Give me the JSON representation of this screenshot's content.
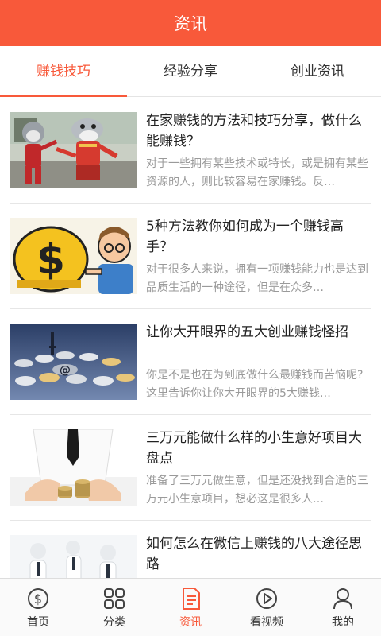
{
  "header": {
    "title": "资讯"
  },
  "tabs": [
    {
      "label": "赚钱技巧",
      "active": true
    },
    {
      "label": "经验分享",
      "active": false
    },
    {
      "label": "创业资讯",
      "active": false
    }
  ],
  "articles": [
    {
      "title": "在家赚钱的方法和技巧分享，做什么能赚钱？",
      "desc": "对于一些拥有某些技术或特长，或是拥有某些资源的人，则比较容易在家赚钱。反…"
    },
    {
      "title": "5种方法教你如何成为一个赚钱高手？",
      "desc": "对于很多人来说，拥有一项赚钱能力也是达到品质生活的一种途径，但是在众多…"
    },
    {
      "title": "让你大开眼界的五大创业赚钱怪招",
      "desc": "你是不是也在为到底做什么最赚钱而苦恼呢?这里告诉你让你大开眼界的5大赚钱…"
    },
    {
      "title": "三万元能做什么样的小生意好项目大盘点",
      "desc": "准备了三万元做生意，但是还没找到合适的三万元小生意项目，想必这是很多人…"
    },
    {
      "title": "如何怎么在微信上赚钱的八大途径思路",
      "desc": ""
    }
  ],
  "bottom_nav": [
    {
      "label": "首页",
      "icon": "dollar-coin-icon",
      "active": false
    },
    {
      "label": "分类",
      "icon": "grid-icon",
      "active": false
    },
    {
      "label": "资讯",
      "icon": "document-icon",
      "active": true
    },
    {
      "label": "看视频",
      "icon": "play-video-icon",
      "active": false
    },
    {
      "label": "我的",
      "icon": "user-icon",
      "active": false
    }
  ],
  "colors": {
    "accent": "#f8593a",
    "text": "#222222",
    "muted": "#9a9a9a",
    "divider": "#e6e6e6"
  }
}
